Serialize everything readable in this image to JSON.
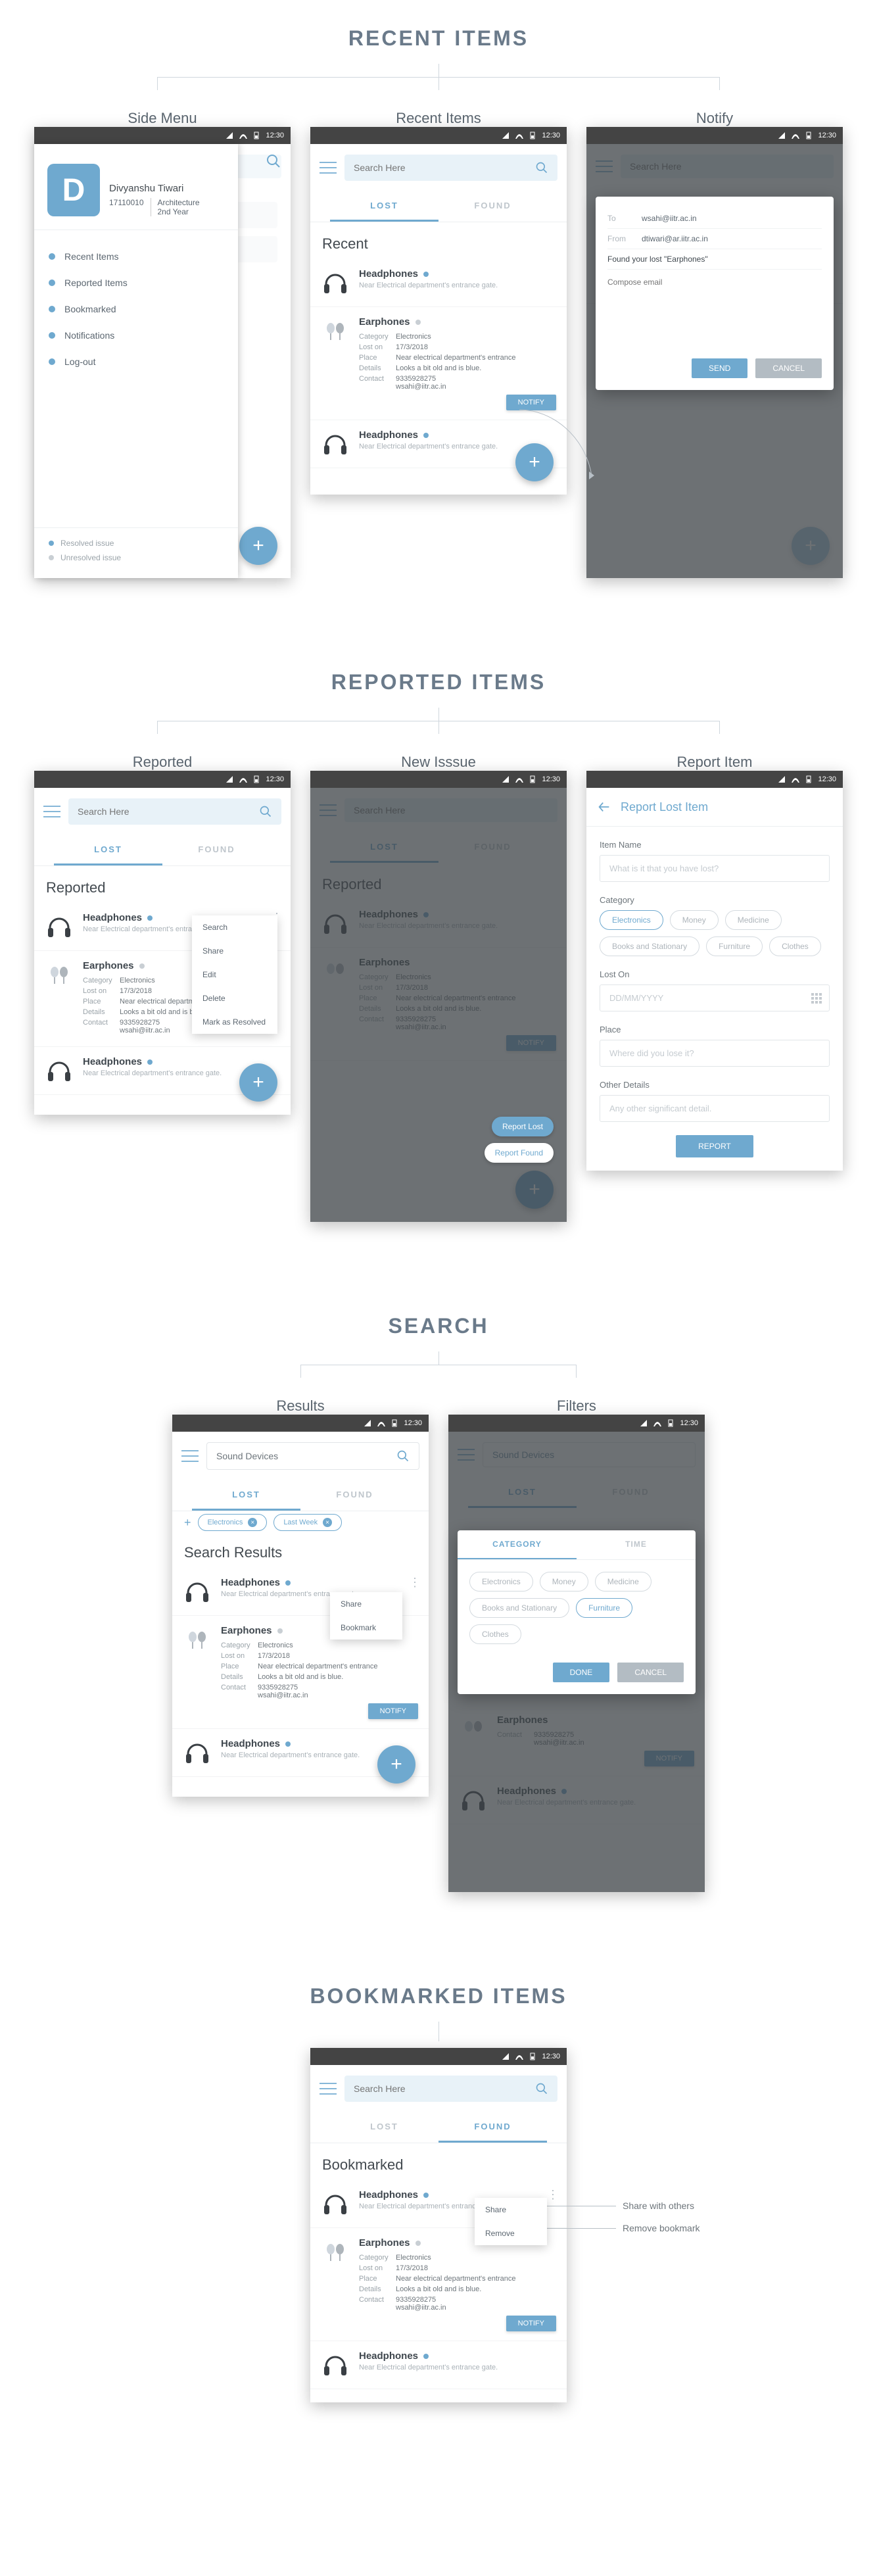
{
  "status": {
    "time": "12:30"
  },
  "common": {
    "search_placeholder": "Search Here",
    "tab_lost": "LOST",
    "tab_found": "FOUND",
    "notify": "NOTIFY",
    "fab_plus": "+"
  },
  "sections": {
    "recent": {
      "title": "RECENT ITEMS",
      "labels": [
        "Side Menu",
        "Recent Items",
        "Notify"
      ]
    },
    "reported": {
      "title": "REPORTED ITEMS",
      "labels": [
        "Reported",
        "New Isssue",
        "Report Item"
      ]
    },
    "search": {
      "title": "SEARCH",
      "labels": [
        "Results",
        "Filters"
      ]
    },
    "bookmarked": {
      "title": "BOOKMARKED ITEMS"
    }
  },
  "side_menu": {
    "avatar_letter": "D",
    "name": "Divyanshu Tiwari",
    "id": "17110010",
    "dept": "Architecture",
    "year": "2nd Year",
    "items": [
      "Recent Items",
      "Reported Items",
      "Bookmarked",
      "Notifications",
      "Log-out"
    ],
    "legend_resolved": "Resolved issue",
    "legend_unresolved": "Unresolved issue"
  },
  "recent_screen": {
    "heading": "Recent",
    "items": [
      {
        "title": "Headphones",
        "sub": "Near Electrical department's entrance gate.",
        "dot": "blue"
      },
      {
        "title": "Earphones",
        "dot": "grey",
        "details": {
          "Category": "Electronics",
          "Lost on": "17/3/2018",
          "Place": "Near electrical department's entrance",
          "Details": "Looks a bit old and is blue.",
          "Contact": "9335928275\nwsahi@iitr.ac.in"
        }
      },
      {
        "title": "Headphones",
        "sub": "Near Electrical department's entrance gate.",
        "dot": "blue"
      }
    ]
  },
  "notify_modal": {
    "to_label": "To",
    "to_val": "wsahi@iitr.ac.in",
    "from_label": "From",
    "from_val": "dtiwari@ar.iitr.ac.in",
    "subject": "Found your lost \"Earphones\"",
    "compose_placeholder": "Compose email",
    "send": "SEND",
    "cancel": "CANCEL"
  },
  "reported_screen": {
    "heading": "Reported",
    "items": [
      {
        "title": "Headphones",
        "sub": "Near Electrical department's entrance gate.",
        "dot": "blue"
      },
      {
        "title": "Earphones",
        "dot": "grey",
        "details": {
          "Category": "Electronics",
          "Lost on": "17/3/2018",
          "Place": "Near electrical department's entrance",
          "Details": "Looks a bit old and is blue.",
          "Contact": "9335928275\nwsahi@iitr.ac.in"
        }
      },
      {
        "title": "Headphones",
        "sub": "Near Electrical department's entrance gate.",
        "dot": "blue"
      }
    ],
    "popup": [
      "Search",
      "Share",
      "Edit",
      "Delete",
      "Mark as Resolved"
    ]
  },
  "new_issue": {
    "chip_lost": "Report Lost",
    "chip_found": "Report Found"
  },
  "report_form": {
    "title": "Report Lost Item",
    "field_name": "Item Name",
    "ph_name": "What is it that you have lost?",
    "field_category": "Category",
    "categories": [
      "Electronics",
      "Money",
      "Medicine",
      "Books and Stationary",
      "Furniture",
      "Clothes"
    ],
    "field_loston": "Lost On",
    "ph_loston": "DD/MM/YYYY",
    "field_place": "Place",
    "ph_place": "Where did you lose it?",
    "field_other": "Other Details",
    "ph_other": "Any other significant detail.",
    "submit": "REPORT"
  },
  "search_screen": {
    "query": "Sound Devices",
    "filter_chips": [
      "Electronics",
      "Last Week"
    ],
    "heading": "Search Results",
    "popup": [
      "Share",
      "Bookmark"
    ]
  },
  "filter_modal": {
    "tab_category": "CATEGORY",
    "tab_time": "TIME",
    "categories": [
      "Electronics",
      "Money",
      "Medicine",
      "Books and Stationary",
      "Furniture",
      "Clothes"
    ],
    "selected": "Furniture",
    "done": "DONE",
    "cancel": "CANCEL"
  },
  "bookmarked_screen": {
    "heading": "Bookmarked",
    "popup": [
      "Share",
      "Remove"
    ],
    "callout_share": "Share with others",
    "callout_remove": "Remove bookmark"
  }
}
